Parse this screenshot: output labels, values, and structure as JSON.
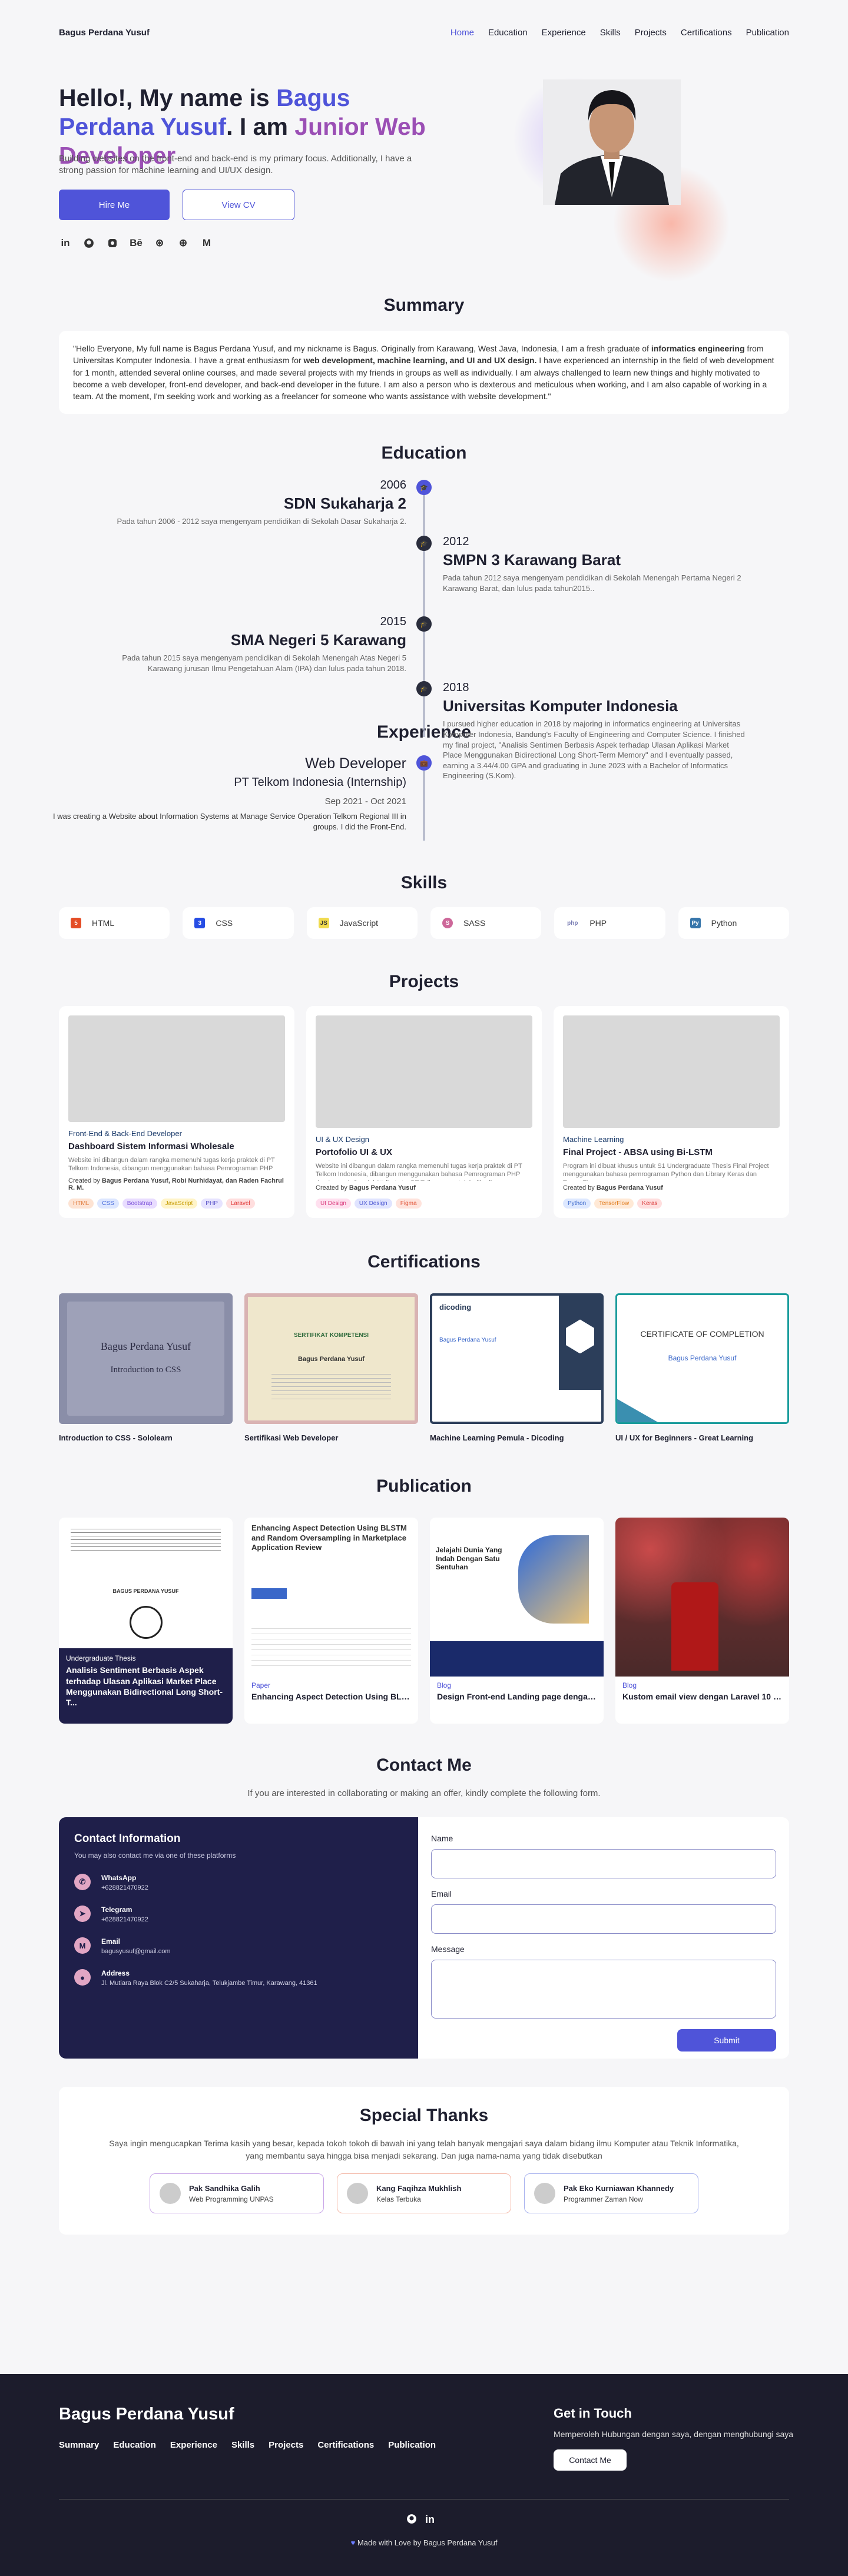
{
  "nav": {
    "brand": "Bagus Perdana Yusuf",
    "links": [
      "Home",
      "Education",
      "Experience",
      "Skills",
      "Projects",
      "Certifications",
      "Publication"
    ]
  },
  "hero": {
    "h_pre": "Hello!, My name is ",
    "h_name": "Bagus Perdana Yusuf",
    "h_mid": ". I am ",
    "h_role": "Junior Web Developer",
    "sub": "Building websites on the front-end and back-end is my primary focus. Additionally, I have a strong passion for machine learning and UI/UX design.",
    "hire": "Hire Me",
    "cv": "View CV",
    "social_icons": [
      "linkedin-icon",
      "github-icon",
      "instagram-icon",
      "behance-icon",
      "dribbble-icon",
      "codepen-icon",
      "medium-icon"
    ],
    "social_glyphs": [
      "in",
      "⌥",
      "◙",
      "Bē",
      "⊛",
      "⊕",
      "M"
    ]
  },
  "summary": {
    "title": "Summary",
    "p1": "\"Hello Everyone, My full name is Bagus Perdana Yusuf, and my nickname is Bagus. Originally from Karawang, West Java, Indonesia, I am a fresh graduate of ",
    "b1": "informatics engineering",
    "p2": " from Universitas Komputer Indonesia. I have a great enthusiasm for ",
    "b2": "web development, machine learning, and UI and UX design.",
    "p3": " I have experienced an internship in the field of web development for 1 month, attended several online courses, and made several projects with my friends in groups as well as individually. I am always challenged to learn new things and highly motivated to become a web developer, front-end developer, and back-end developer in the future. I am also a person who is dexterous and meticulous when working, and I am also capable of working in a team. At the moment, I'm seeking work and working as a freelancer for someone who wants assistance with website development.\""
  },
  "education": {
    "title": "Education",
    "items": [
      {
        "year": "2006",
        "name": "SDN Sukaharja 2",
        "desc": "Pada tahun 2006 - 2012 saya mengenyam pendidikan di Sekolah Dasar Sukaharja 2."
      },
      {
        "year": "2012",
        "name": "SMPN 3 Karawang Barat",
        "desc": "Pada tahun 2012 saya mengenyam pendidikan di Sekolah Menengah Pertama Negeri 2 Karawang Barat, dan lulus pada tahun2015.."
      },
      {
        "year": "2015",
        "name": "SMA Negeri 5 Karawang",
        "desc": "Pada tahun 2015 saya mengenyam pendidikan di Sekolah Menengah Atas Negeri 5 Karawang jurusan Ilmu Pengetahuan Alam (IPA) dan lulus pada tahun 2018."
      },
      {
        "year": "2018",
        "name": "Universitas Komputer Indonesia",
        "desc": "I pursued higher education in 2018 by majoring in informatics engineering at Universitas Komputer Indonesia, Bandung's Faculty of Engineering and Computer Science. I finished my final project, \"Analisis Sentimen Berbasis Aspek terhadap Ulasan Aplikasi Market Place Menggunakan Bidirectional Long Short-Term Memory\" and I eventually passed, earning a 3.44/4.00 GPA and graduating in June 2023 with a Bachelor of Informatics Engineering (S.Kom)."
      }
    ]
  },
  "experience": {
    "title": "Experience",
    "role": "Web Developer",
    "company": "PT Telkom Indonesia (Internship)",
    "date": "Sep 2021 - Oct 2021",
    "desc": "I was creating a Website about Information Systems at Manage Service Operation Telkom Regional III in groups. I did the Front-End."
  },
  "skills": {
    "title": "Skills",
    "items": [
      {
        "label": "HTML",
        "icon": "html5-icon",
        "glyph": "5",
        "color": "#e44d26"
      },
      {
        "label": "CSS",
        "icon": "css3-icon",
        "glyph": "3",
        "color": "#264de4"
      },
      {
        "label": "JavaScript",
        "icon": "javascript-icon",
        "glyph": "JS",
        "color": "#f0db4f"
      },
      {
        "label": "SASS",
        "icon": "sass-icon",
        "glyph": "S",
        "color": "#cd6799"
      },
      {
        "label": "PHP",
        "icon": "php-icon",
        "glyph": "php",
        "color": "#777bb3"
      },
      {
        "label": "Python",
        "icon": "python-icon",
        "glyph": "Py",
        "color": "#3776ab"
      }
    ]
  },
  "projects": {
    "title": "Projects",
    "items": [
      {
        "cat": "Front-End & Back-End Developer",
        "title": "Dashboard Sistem Informasi Wholesale",
        "desc": "Website ini dibangun dalam rangka memenuhi tugas kerja praktek di PT Telkom Indonesia, dibangun menggunakan bahasa Pemrograman PHP dan Laravel. Special Attribute to: PT Telkom yang telah diberika...",
        "by_label": "Created by ",
        "by": "Bagus Perdana Yusuf, Robi Nurhidayat, dan Raden Fachrul R. M.",
        "tags": [
          {
            "t": "HTML",
            "bg": "#fde3d3",
            "c": "#e07b3c"
          },
          {
            "t": "CSS",
            "bg": "#dce6ff",
            "c": "#3e63d9"
          },
          {
            "t": "Bootstrap",
            "bg": "#e8dcff",
            "c": "#7a4fd9"
          },
          {
            "t": "JavaScript",
            "bg": "#fff4c8",
            "c": "#c59a00"
          },
          {
            "t": "PHP",
            "bg": "#e6e3ff",
            "c": "#5b55c9"
          },
          {
            "t": "Laravel",
            "bg": "#ffdede",
            "c": "#e03a3a"
          }
        ]
      },
      {
        "cat": "UI & UX Design",
        "title": "Portofolio UI & UX",
        "desc": "Website ini dibangun dalam rangka memenuhi tugas kerja praktek di PT Telkom Indonesia, dibangun menggunakan bahasa Pemrograman PHP dan Laravel. Special Attribute to: PT Telkom yang telah diberika...",
        "by_label": "Created by ",
        "by": "Bagus Perdana Yusuf",
        "tags": [
          {
            "t": "UI Design",
            "bg": "#ffe0ef",
            "c": "#d9387a"
          },
          {
            "t": "UX Design",
            "bg": "#e0e4ff",
            "c": "#4a55d1"
          },
          {
            "t": "Figma",
            "bg": "#ffe3dc",
            "c": "#e0553a"
          }
        ]
      },
      {
        "cat": "Machine Learning",
        "title": "Final Project - ABSA using Bi-LSTM",
        "desc": "Program ini dibuat khusus untuk S1 Undergraduate Thesis Final Project menggunakan bahasa pemrograman Python dan Library Keras dan TensorFlow.",
        "by_label": "Created by ",
        "by": "Bagus Perdana Yusuf",
        "tags": [
          {
            "t": "Python",
            "bg": "#dde8ff",
            "c": "#3a67c9"
          },
          {
            "t": "TensorFlow",
            "bg": "#ffe9d6",
            "c": "#e07b1c"
          },
          {
            "t": "Keras",
            "bg": "#ffdede",
            "c": "#d93a3a"
          }
        ]
      }
    ]
  },
  "certifications": {
    "title": "Certifications",
    "items": [
      {
        "caption": "Introduction to CSS - Sololearn",
        "inner_title": "Bagus Perdana Yusuf",
        "inner_sub": "Introduction to CSS"
      },
      {
        "caption": "Sertifikasi Web Developer",
        "inner_title": "SERTIFIKAT KOMPETENSI",
        "inner_sub": "Bagus Perdana Yusuf"
      },
      {
        "caption": "Machine Learning Pemula - Dicoding",
        "inner_title": "dicoding",
        "inner_sub": "Bagus Perdana Yusuf"
      },
      {
        "caption": "UI / UX for Beginners - Great Learning",
        "inner_title": "CERTIFICATE OF COMPLETION",
        "inner_sub": "Bagus Perdana Yusuf"
      }
    ]
  },
  "publication": {
    "title": "Publication",
    "items": [
      {
        "kind": "Undergraduate Thesis",
        "title": "Analisis Sentiment Berbasis Aspek terhadap Ulasan Aplikasi Market Place Menggunakan Bidirectional Long Short-T...",
        "inner": "BAGUS PERDANA YUSUF"
      },
      {
        "kind": "Paper",
        "title": "Enhancing Aspect Detection Using BLST...",
        "inner": "Enhancing Aspect Detection Using BLSTM and Random Oversampling in Marketplace Application Review"
      },
      {
        "kind": "Blog",
        "title": "Design Front-end Landing page dengan...",
        "inner": "Jelajahi Dunia Yang Indah Dengan Satu Sentuhan"
      },
      {
        "kind": "Blog",
        "title": "Kustom email view dengan Laravel 10 bl...",
        "inner": ""
      }
    ]
  },
  "contact": {
    "title": "Contact Me",
    "sub": "If you are interested in collaborating or making an offer, kindly complete the following form.",
    "info_title": "Contact Information",
    "info_sub": "You may also contact me via one of these platforms",
    "rows": [
      {
        "label": "WhatsApp",
        "value": "+628821470922",
        "icon": "whatsapp-icon",
        "glyph": "✆"
      },
      {
        "label": "Telegram",
        "value": "+628821470922",
        "icon": "telegram-icon",
        "glyph": "➤"
      },
      {
        "label": "Email",
        "value": "bagusyusuf@gmail.com",
        "icon": "email-icon",
        "glyph": "M"
      },
      {
        "label": "Address",
        "value": "Jl. Mutiara Raya Blok C2/5 Sukaharja, Telukjambe Timur, Karawang, 41361",
        "icon": "location-icon",
        "glyph": "●"
      }
    ],
    "name_label": "Name",
    "email_label": "Email",
    "message_label": "Message",
    "submit": "Submit"
  },
  "thanks": {
    "title": "Special Thanks",
    "text": "Saya ingin mengucapkan Terima kasih yang besar, kepada tokoh tokoh di bawah ini yang telah banyak mengajari saya dalam bidang ilmu Komputer atau Teknik Informatika, yang membantu saya hingga bisa menjadi sekarang. Dan juga nama-nama yang tidak disebutkan",
    "people": [
      {
        "name": "Pak Sandhika Galih",
        "desc": "Web Programming UNPAS",
        "border": "#c9a6e8"
      },
      {
        "name": "Kang Faqihza Mukhlish",
        "desc": "Kelas Terbuka",
        "border": "#f4b9a8"
      },
      {
        "name": "Pak Eko Kurniawan Khannedy",
        "desc": "Programmer Zaman Now",
        "border": "#a9b3ef"
      }
    ]
  },
  "footer": {
    "brand": "Bagus Perdana Yusuf",
    "links": [
      "Summary",
      "Education",
      "Experience",
      "Skills",
      "Projects",
      "Certifications",
      "Publication"
    ],
    "touch": "Get in Touch",
    "touch_sub": "Memperoleh Hubungan dengan saya, dengan menghubungi saya",
    "btn": "Contact Me",
    "copy": "Made with Love by Bagus Perdana Yusuf"
  }
}
